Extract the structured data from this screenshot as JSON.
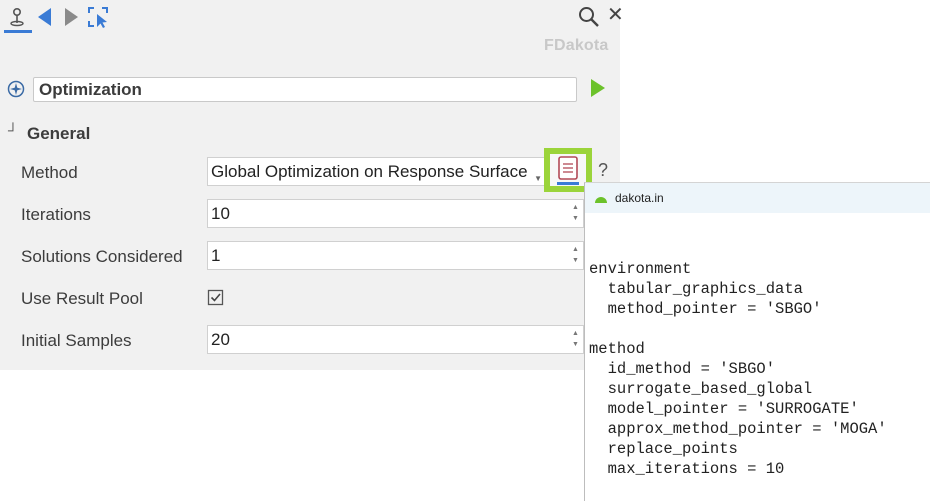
{
  "header": {
    "brand": "FDakota"
  },
  "study": {
    "name": "Optimization"
  },
  "section": {
    "title": "General"
  },
  "fields": {
    "method": {
      "label": "Method",
      "value": "Global Optimization on Response Surface"
    },
    "iterations": {
      "label": "Iterations",
      "value": "10"
    },
    "solutions": {
      "label": "Solutions Considered",
      "value": "1"
    },
    "result_pool": {
      "label": "Use Result Pool",
      "checked": true
    },
    "samples": {
      "label": "Initial Samples",
      "value": "20"
    }
  },
  "help": {
    "label": "?"
  },
  "popup": {
    "title": "dakota.in",
    "lines": [
      "environment",
      "  tabular_graphics_data",
      "  method_pointer = 'SBGO'",
      "",
      "method",
      "  id_method = 'SBGO'",
      "  surrogate_based_global",
      "  model_pointer = 'SURROGATE'",
      "  approx_method_pointer = 'MOGA'",
      "  replace_points",
      "  max_iterations = 10"
    ]
  },
  "colors": {
    "accent_blue": "#3a7bd5",
    "run_green": "#6cc22b",
    "highlight_green": "#9bd43a"
  }
}
